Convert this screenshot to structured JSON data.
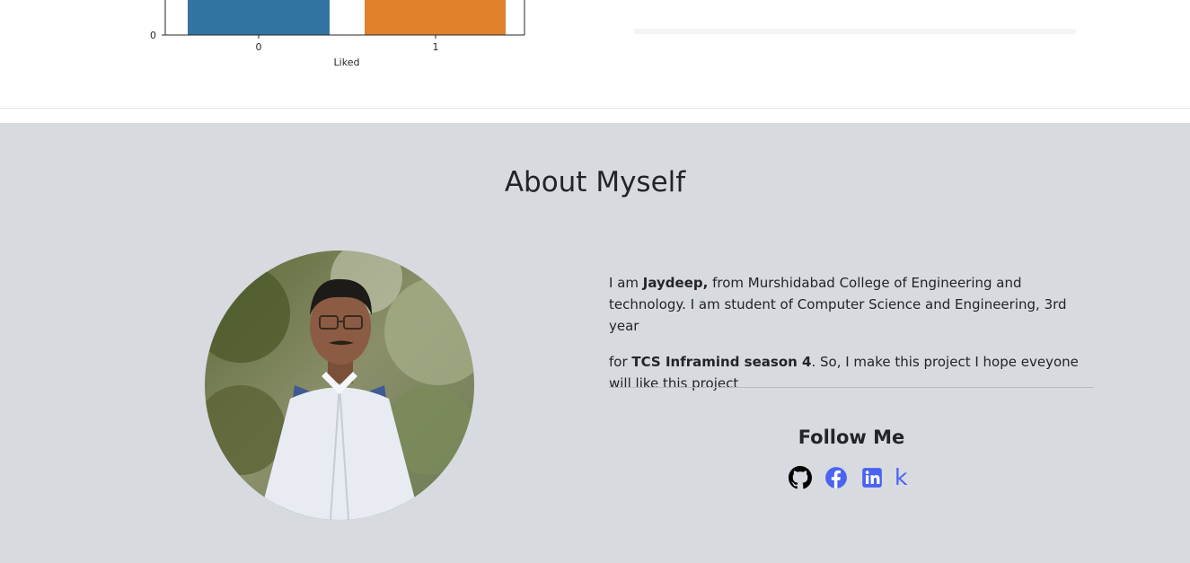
{
  "chart_data": {
    "type": "bar",
    "categories": [
      "0",
      "1"
    ],
    "values": [
      null,
      null
    ],
    "xlabel": "Liked",
    "ylabel": "",
    "y_ticks": [
      "0"
    ],
    "colors": [
      "#3274a1",
      "#e1812c"
    ],
    "grid": false
  },
  "about": {
    "title": "About Myself",
    "bio_p1_prefix": "I am ",
    "bio_p1_name": "Jaydeep,",
    "bio_p1_rest": " from Murshidabad College of Engineering and technology. I am student of Computer Science and Engineering, 3rd year",
    "bio_p2_prefix": "for ",
    "bio_p2_bold": "TCS Inframind season 4",
    "bio_p2_rest": ". So, I make this project I hope eveyone will like this project"
  },
  "follow": {
    "title": "Follow Me",
    "icons": [
      "github-icon",
      "facebook-icon",
      "linkedin-icon",
      "kaggle-icon"
    ],
    "kaggle_glyph": "k",
    "accent_color": "#4a63f0"
  }
}
